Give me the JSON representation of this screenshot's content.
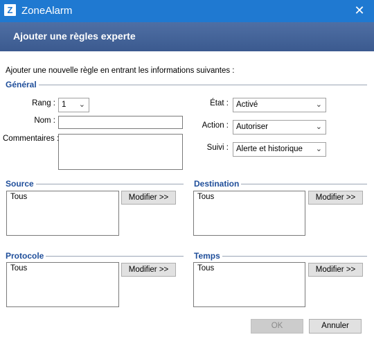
{
  "window": {
    "logo_letter": "Z",
    "title": "ZoneAlarm",
    "close_glyph": "✕"
  },
  "header": {
    "title": "Ajouter une règles experte"
  },
  "intro": "Ajouter une nouvelle règle en entrant les informations suivantes :",
  "general": {
    "title": "Général",
    "rank_label": "Rang :",
    "rank_value": "1",
    "name_label": "Nom :",
    "name_value": "",
    "comments_label": "Commentaires :",
    "comments_value": "",
    "state_label": "État :",
    "state_value": "Activé",
    "action_label": "Action :",
    "action_value": "Autoriser",
    "track_label": "Suivi :",
    "track_value": "Alerte et historique"
  },
  "source": {
    "title": "Source",
    "items": [
      "Tous"
    ],
    "modify_label": "Modifier >>"
  },
  "destination": {
    "title": "Destination",
    "items": [
      "Tous"
    ],
    "modify_label": "Modifier >>"
  },
  "protocol": {
    "title": "Protocole",
    "items": [
      "Tous"
    ],
    "modify_label": "Modifier >>"
  },
  "time": {
    "title": "Temps",
    "items": [
      "Tous"
    ],
    "modify_label": "Modifier >>"
  },
  "footer": {
    "ok_label": "OK",
    "cancel_label": "Annuler"
  },
  "colors": {
    "titlebar": "#1f79d1",
    "header": "#46659a",
    "group_title": "#1f4e9a"
  },
  "icons": {
    "dropdown": "chevron-down-icon",
    "close": "close-icon"
  }
}
